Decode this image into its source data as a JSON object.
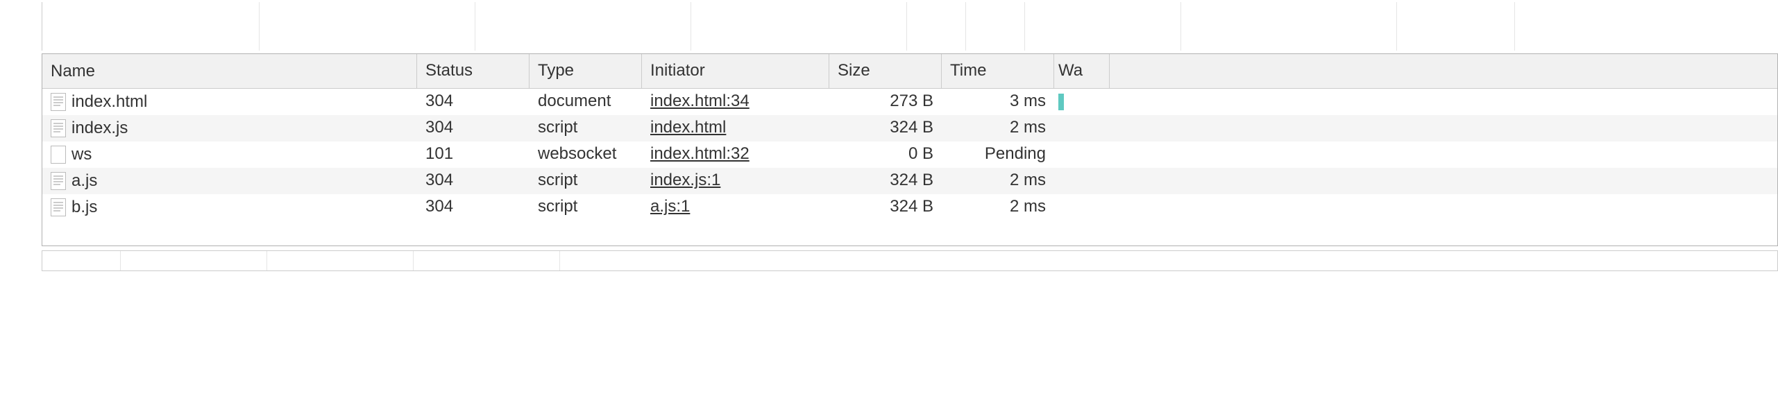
{
  "columns": {
    "name": "Name",
    "status": "Status",
    "type": "Type",
    "initiator": "Initiator",
    "size": "Size",
    "time": "Time",
    "waterfall": "Wa"
  },
  "rows": [
    {
      "name": "index.html",
      "status": "304",
      "type": "document",
      "initiator": "index.html:34",
      "size": "273 B",
      "time": "3 ms",
      "iconType": "doc",
      "hasWaterfall": true
    },
    {
      "name": "index.js",
      "status": "304",
      "type": "script",
      "initiator": "index.html",
      "size": "324 B",
      "time": "2 ms",
      "iconType": "doc",
      "hasWaterfall": false
    },
    {
      "name": "ws",
      "status": "101",
      "type": "websocket",
      "initiator": "index.html:32",
      "size": "0 B",
      "time": "Pending",
      "timePending": true,
      "iconType": "blank",
      "hasWaterfall": false
    },
    {
      "name": "a.js",
      "status": "304",
      "type": "script",
      "initiator": "index.js:1",
      "size": "324 B",
      "time": "2 ms",
      "iconType": "doc",
      "hasWaterfall": false
    },
    {
      "name": "b.js",
      "status": "304",
      "type": "script",
      "initiator": "a.js:1",
      "size": "324 B",
      "time": "2 ms",
      "iconType": "doc",
      "hasWaterfall": false
    }
  ],
  "topStripWidths": [
    313,
    311,
    311,
    311,
    85,
    85,
    225,
    311,
    170
  ],
  "bottomStripWidths": [
    113,
    211,
    211,
    211
  ]
}
